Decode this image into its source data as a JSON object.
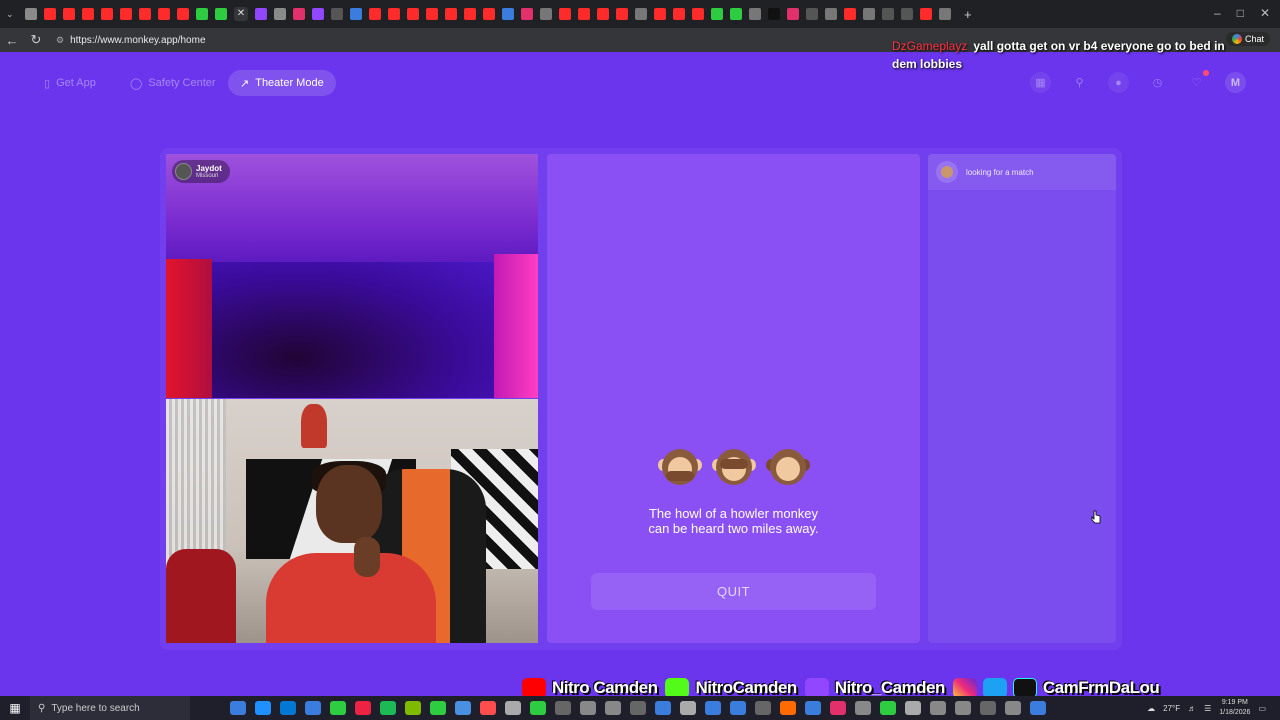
{
  "browser": {
    "url": "https://www.monkey.app/home",
    "tab_colors": [
      "#8a8a8a",
      "#ff2a2a",
      "#ff2a2a",
      "#ff2a2a",
      "#ff2a2a",
      "#ff2a2a",
      "#ff2a2a",
      "#ff2a2a",
      "#ff2a2a",
      "#2ecc40",
      "#2ecc40",
      "#35363a",
      "#9146ff",
      "#8a8a8a",
      "#e1306c",
      "#9146ff",
      "#555555",
      "#3b7ddd",
      "#ff2a2a",
      "#ff2a2a",
      "#ff2a2a",
      "#ff2a2a",
      "#ff2a2a",
      "#ff2a2a",
      "#ff2a2a",
      "#3b7ddd",
      "#e1306c",
      "#777777",
      "#ff2a2a",
      "#ff2a2a",
      "#ff2a2a",
      "#ff2a2a",
      "#777777",
      "#ff2a2a",
      "#ff2a2a",
      "#ff2a2a",
      "#2ecc40",
      "#2ecc40",
      "#777777",
      "#111111",
      "#e1306c",
      "#555555",
      "#777777",
      "#ff2a2a",
      "#777777",
      "#555555",
      "#555555",
      "#ff2a2a",
      "#777777"
    ],
    "active_tab_icon": "close-icon",
    "new_tab_icon": "plus-icon"
  },
  "overlay_chat": {
    "username": "DzGameplayz",
    "message": "yall gotta get on vr b4 everyone go to bed in dem lobbies",
    "chat_button": "Chat"
  },
  "header": {
    "get_app": "Get App",
    "safety_center": "Safety Center",
    "theater_mode": "Theater Mode",
    "avatar_letter": "M",
    "icons": [
      "shop-icon",
      "search-icon",
      "monkey-icon",
      "history-icon",
      "messages-icon"
    ]
  },
  "remote_user": {
    "name": "Jaydot",
    "location": "Missouri"
  },
  "match_panel": {
    "fact_line1": "The howl of a howler monkey",
    "fact_line2": "can be heard two miles away.",
    "quit_label": "QUIT",
    "monkey_icons": [
      "speak-no-evil-monkey-icon",
      "see-no-evil-monkey-icon",
      "hear-no-evil-monkey-icon"
    ]
  },
  "chat_panel": {
    "status": "looking for a match"
  },
  "socials": {
    "youtube": "Nitro Camden",
    "kick": "NitroCamden",
    "twitch": "Nitro_Camden",
    "instagram_twitter_tiktok": "CamFrmDaLou"
  },
  "taskbar": {
    "search_placeholder": "Type here to search",
    "temperature": "27°F",
    "time": "9:19 PM",
    "date": "1/18/2026",
    "app_colors": [
      "#3b7ddd",
      "#1e90ff",
      "#0078d4",
      "#3b7ddd",
      "#2ecc40",
      "#e24",
      "#1db954",
      "#7fba00",
      "#2ecc40",
      "#4a90e2",
      "#ff4d4d",
      "#aaaaaa",
      "#2ecc40",
      "#666",
      "#888",
      "#888",
      "#666",
      "#3b7ddd",
      "#aaaaaa",
      "#3b7ddd",
      "#3b7ddd",
      "#666",
      "#ff6b00",
      "#3b7ddd",
      "#e1306c",
      "#888",
      "#2ecc40",
      "#aaaaaa",
      "#888",
      "#888",
      "#666",
      "#888",
      "#3b7ddd"
    ]
  }
}
